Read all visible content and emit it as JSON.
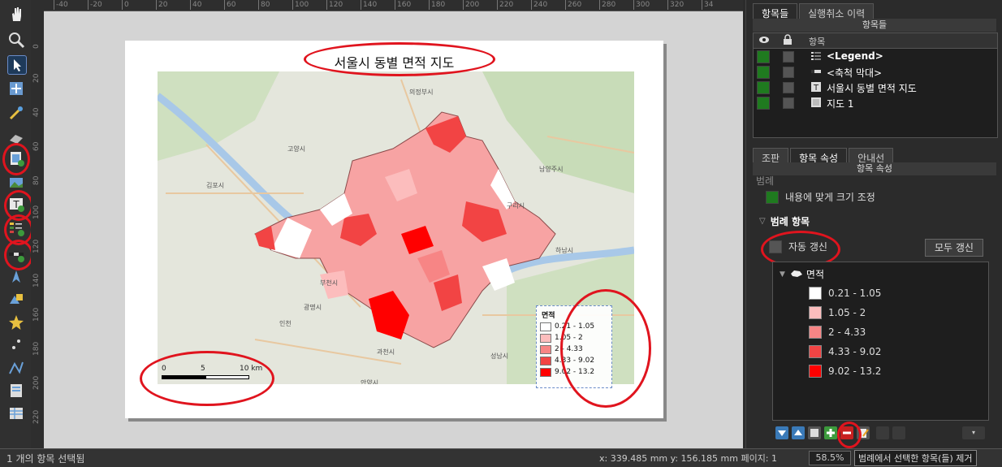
{
  "canvas": {
    "map_title": "서울시 동별 면적 지도",
    "scalebar": {
      "labels": [
        "0",
        "5",
        "10 km"
      ]
    },
    "legend": {
      "title": "면적",
      "classes": [
        {
          "label": "0.21 - 1.05",
          "color": "#ffffff"
        },
        {
          "label": "1.05 - 2",
          "color": "#fcbdbd"
        },
        {
          "label": "2 - 4.33",
          "color": "#f78585"
        },
        {
          "label": "4.33 - 9.02",
          "color": "#f24444"
        },
        {
          "label": "9.02 - 13.2",
          "color": "#ff0000"
        }
      ]
    },
    "place_labels": [
      "고양시",
      "김포시",
      "부천시",
      "인천",
      "광명시",
      "과천시",
      "안양시",
      "성남시",
      "구리시",
      "남양주시",
      "하남시",
      "의정부시"
    ]
  },
  "hruler": {
    "ticks": [
      "-40",
      "-20",
      "0",
      "20",
      "40",
      "60",
      "80",
      "100",
      "120",
      "140",
      "160",
      "180",
      "200",
      "220",
      "240",
      "260",
      "280",
      "300",
      "320",
      "34"
    ]
  },
  "vruler": {
    "ticks": [
      "0",
      "20",
      "40",
      "60",
      "80",
      "100",
      "120",
      "140",
      "160",
      "180",
      "200",
      "220"
    ]
  },
  "dock": {
    "top_tabs": [
      "항목들",
      "실행취소 이력"
    ],
    "items_header": "항목들",
    "items_column": "항목",
    "items": [
      {
        "label": "<Legend>",
        "bold": true,
        "icon": "legend-icon"
      },
      {
        "label": "<축척 막대>",
        "bold": false,
        "icon": "scalebar-icon"
      },
      {
        "label": "서울시 동별 면적 지도",
        "bold": false,
        "icon": "text-icon"
      },
      {
        "label": "지도 1",
        "bold": false,
        "icon": "map-icon"
      }
    ],
    "bottom_tabs": [
      "조판",
      "항목 속성",
      "안내선"
    ],
    "props_header": "항목 속성",
    "section_cut": "범례",
    "resize_label": "내용에 맞게 크기 조정",
    "legend_items_section": "범례 항목",
    "auto_update_label": "자동 갱신",
    "update_all_button": "모두 갱신",
    "layer_name": "면적",
    "legend_classes": [
      {
        "label": "0.21 - 1.05",
        "color": "#ffffff"
      },
      {
        "label": "1.05 - 2",
        "color": "#fcbdbd"
      },
      {
        "label": "2 - 4.33",
        "color": "#f78585"
      },
      {
        "label": "4.33 - 9.02",
        "color": "#f24444"
      },
      {
        "label": "9.02 - 13.2",
        "color": "#ff0000"
      }
    ]
  },
  "status": {
    "selection": "1 개의 항목 선택됨",
    "coords": "x: 339.485 mm  y: 156.185 mm  페이지: 1",
    "zoom": "58.5%",
    "tooltip": "범례에서 선택한 항목(들) 제거"
  },
  "colors": {
    "annotation": "#e0141e",
    "accent_green": "#1f7a1f"
  }
}
